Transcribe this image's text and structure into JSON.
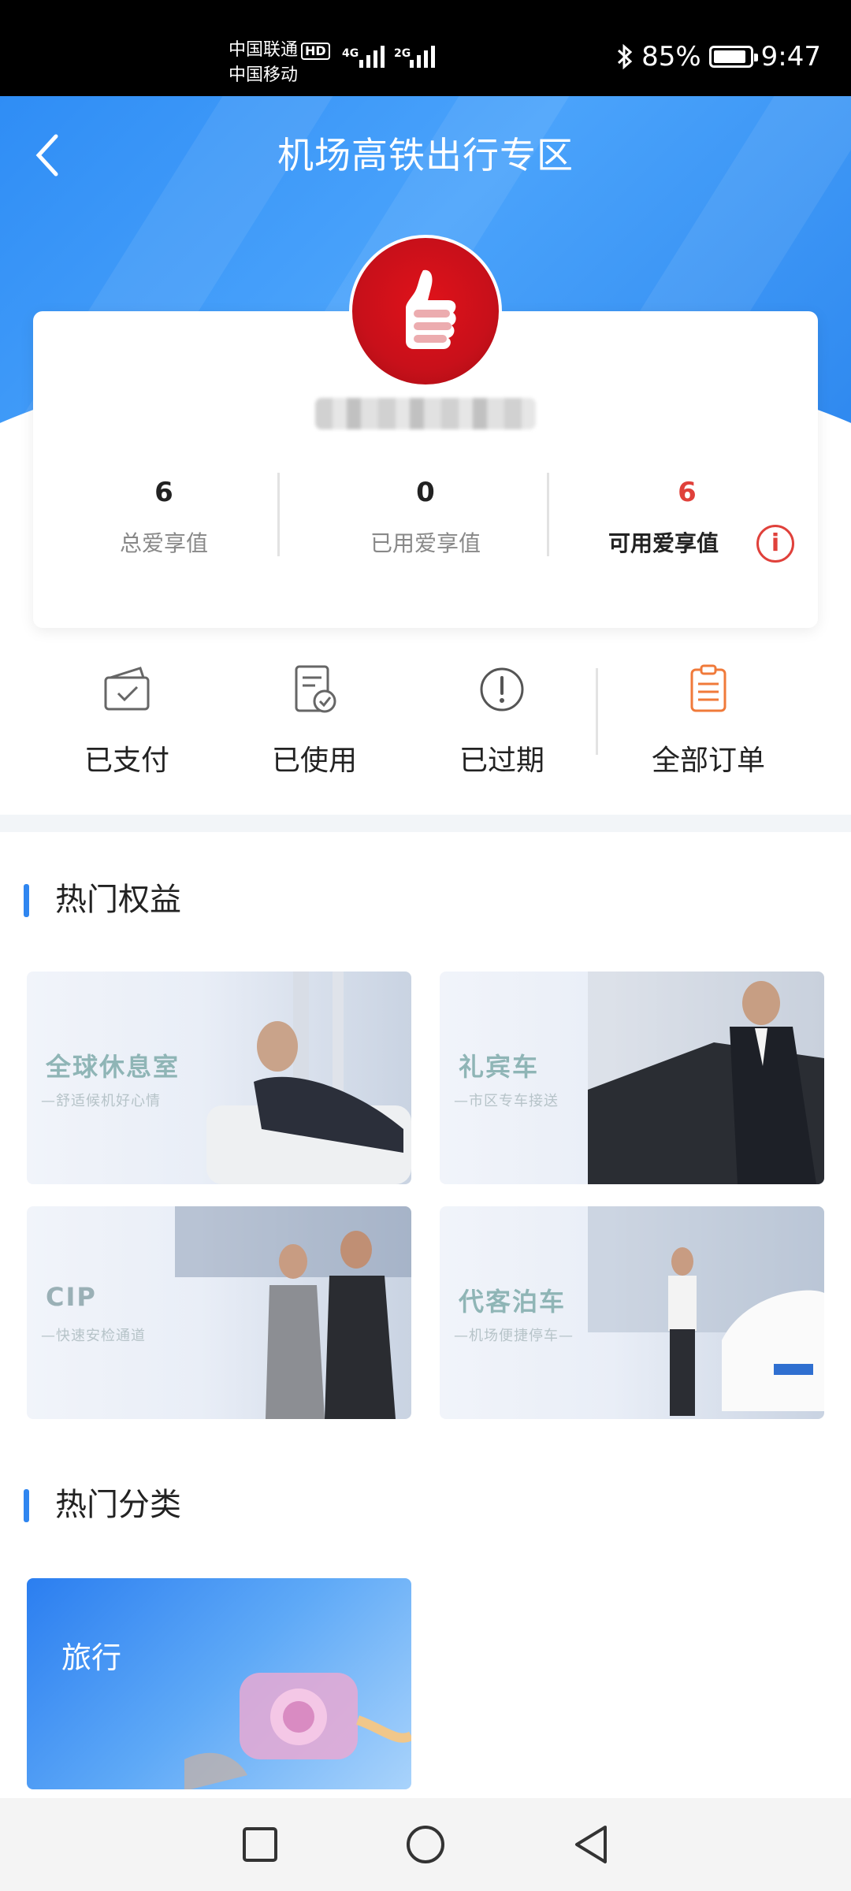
{
  "status_bar": {
    "carrier1": "中国联通",
    "hd_badge": "HD",
    "carrier2": "中国移动",
    "net1": "4G",
    "net2": "2G",
    "battery": "85%",
    "time": "9:47"
  },
  "header": {
    "title": "机场高铁出行专区"
  },
  "stats": [
    {
      "value": "6",
      "label": "总爱享值"
    },
    {
      "value": "0",
      "label": "已用爱享值"
    },
    {
      "value": "6",
      "label": "可用爱享值"
    }
  ],
  "orders": [
    {
      "label": "已支付",
      "icon": "paid-wallet-icon"
    },
    {
      "label": "已使用",
      "icon": "used-document-icon"
    },
    {
      "label": "已过期",
      "icon": "expired-alert-icon"
    },
    {
      "label": "全部订单",
      "icon": "all-orders-clipboard-icon"
    }
  ],
  "hot_benefits": {
    "title": "热门权益",
    "items": [
      {
        "title": "全球休息室",
        "subtitle": "—舒适候机好心情"
      },
      {
        "title": "礼宾车",
        "subtitle": "—市区专车接送"
      },
      {
        "title": "CIP",
        "subtitle": "—快速安检通道"
      },
      {
        "title": "代客泊车",
        "subtitle": "—机场便捷停车—"
      }
    ]
  },
  "hot_categories": {
    "title": "热门分类",
    "items": [
      {
        "label": "旅行"
      }
    ]
  },
  "colors": {
    "primary_blue": "#2f86f0",
    "accent_red": "#e0413b",
    "orange_icon": "#f07a3a"
  }
}
